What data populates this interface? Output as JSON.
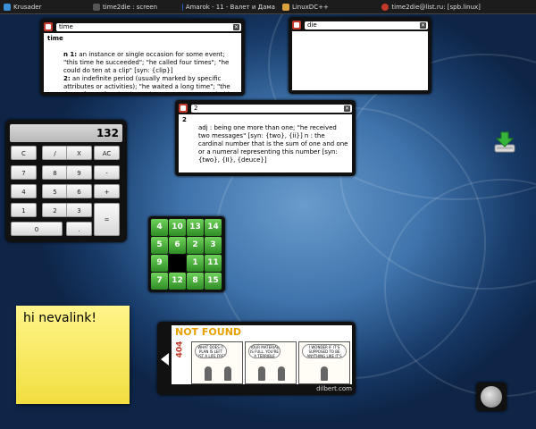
{
  "taskbar": {
    "tasks": [
      {
        "label": "Krusader",
        "icon": "krusader-icon",
        "color": "#3b8fd9"
      },
      {
        "label": "time2die : screen",
        "icon": "terminal-icon",
        "color": "#555555"
      },
      {
        "label": "Amarok - 11 - Валет и Дама",
        "icon": "amarok-icon",
        "color": "#2a6fd1"
      },
      {
        "label": "LinuxDC++",
        "icon": "linuxdcpp-icon",
        "color": "#d9a23b"
      },
      {
        "label": "time2die@list.ru: [spb.linux]",
        "icon": "chat-icon",
        "color": "#c0392b"
      }
    ]
  },
  "dict_time": {
    "query": "time",
    "headword": "time",
    "lines": [
      {
        "num": "n 1:",
        "text": " an instance or single occasion for some event; \"this time he succeeded\"; \"he called four times\"; \"he could do ten at a clip\" [syn: {clip}]"
      },
      {
        "num": "2:",
        "text": " an indefinite period (usually marked by specific attributes or activities); \"he waited a long time\"; \"the time of year for planting\"; \"he was a great actor in his time\""
      }
    ]
  },
  "dict_die": {
    "query": "die"
  },
  "dict_two": {
    "query": "2",
    "headword": "2",
    "text": "adj : being one more than one; \"he received two messages\" [syn: {two}, {ii}] n : the cardinal number that is the sum of one and one or a numeral representing this number [syn: {two}, {II}, {deuce}]"
  },
  "calculator": {
    "display": "132",
    "buttons": [
      "C",
      "/",
      "X",
      "AC",
      "7",
      "8",
      "9",
      "-",
      "4",
      "5",
      "6",
      "+",
      "1",
      "2",
      "3",
      "=",
      "0",
      "."
    ]
  },
  "puzzle": {
    "tiles": [
      "4",
      "10",
      "13",
      "14",
      "5",
      "6",
      "2",
      "3",
      "9",
      "",
      "1",
      "11",
      "7",
      "12",
      "8",
      "15"
    ]
  },
  "note": {
    "text": "hi nevalink!"
  },
  "comic": {
    "not_found": "NOT FOUND",
    "code": "404",
    "panels": [
      "WHAT DOES IT PLAN IS LEFT JUST A LIFE FREE THEY SAYS WHY",
      "YOUR MATERIAL IS FULL. YOU'RE A TERRIBLE",
      "I WONDER IF IT'S SUPPOSED TO BE ANYTHING LIKE IT'S DRAWING"
    ],
    "source": "dilbert.com"
  },
  "colors": {
    "accent_green": "#3fa83a",
    "note_yellow": "#f8ea5a",
    "dict_icon_red": "#c0392b"
  }
}
